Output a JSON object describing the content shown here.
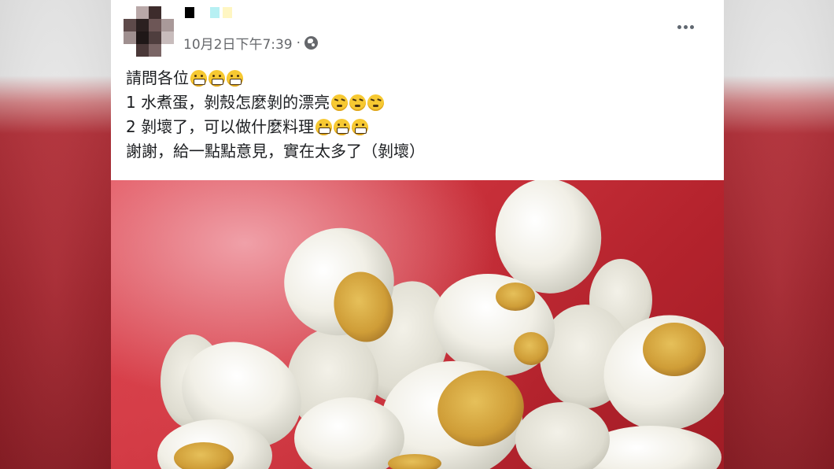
{
  "post": {
    "author": {
      "name_blocks": [
        "#000000",
        "#ffffff",
        "#b7f0f3",
        "#fff6c2"
      ]
    },
    "timestamp": "10月2日下午7:39",
    "separator": "·",
    "privacy_icon": "globe-icon",
    "more_icon": "more-horizontal-icon",
    "text_lines": [
      {
        "text": "請問各位",
        "emoji": "grimacing-face-emoji",
        "emoji_count": 3
      },
      {
        "text": "1 水煮蛋，剝殼怎麼剝的漂亮",
        "emoji": "steam-from-nose-emoji",
        "emoji_count": 3
      },
      {
        "text": "2 剝壞了，可以做什麼料理",
        "emoji": "grimacing-face-emoji",
        "emoji_count": 3
      },
      {
        "text": "謝謝，給一點點意見，實在太多了（剝壞）",
        "emoji": "",
        "emoji_count": 0
      }
    ],
    "photo": {
      "subject": "peeled-boiled-eggs-photo"
    }
  },
  "colors": {
    "card_background": "#ffffff",
    "text": "#1c1e21",
    "meta_text": "#65676b",
    "photo_bowl_red": "#c9303a",
    "yolk": "#d9a73c",
    "egg_white": "#f3f1ea"
  }
}
